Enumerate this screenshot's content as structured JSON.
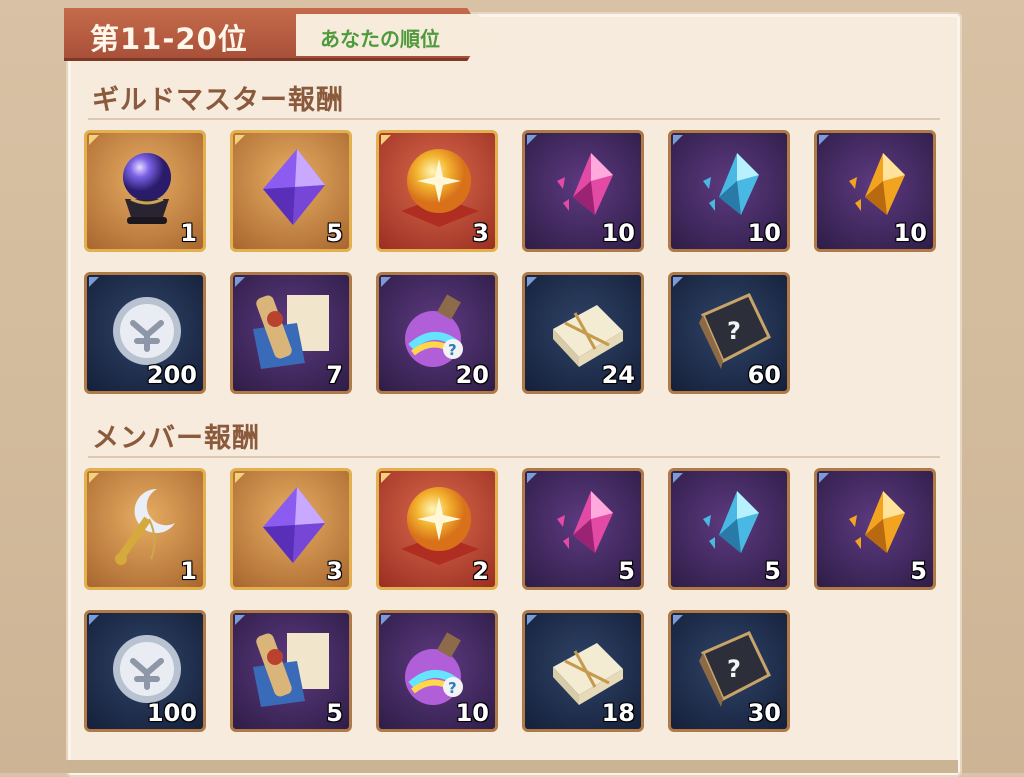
{
  "header": {
    "rank_title": "第11-20位",
    "your_rank_label": "あなたの順位"
  },
  "sections": [
    {
      "title": "ギルドマスター報酬",
      "items": [
        {
          "icon": "crystal-ball-icon",
          "count": "1",
          "frame": "gold"
        },
        {
          "icon": "purple-diamond-icon",
          "count": "5",
          "frame": "gold"
        },
        {
          "icon": "golden-orb-icon",
          "count": "3",
          "frame": "red"
        },
        {
          "icon": "pink-crystal-icon",
          "count": "10",
          "frame": "purple"
        },
        {
          "icon": "blue-crystal-icon",
          "count": "10",
          "frame": "purple"
        },
        {
          "icon": "gold-crystal-icon",
          "count": "10",
          "frame": "purple"
        },
        {
          "icon": "silver-coin-icon",
          "count": "200",
          "frame": "navy"
        },
        {
          "icon": "scroll-book-icon",
          "count": "7",
          "frame": "purple"
        },
        {
          "icon": "potion-icon",
          "count": "20",
          "frame": "purple"
        },
        {
          "icon": "paper-bundle-icon",
          "count": "24",
          "frame": "navy"
        },
        {
          "icon": "mystery-book-icon",
          "count": "60",
          "frame": "navy"
        }
      ]
    },
    {
      "title": "メンバー報酬",
      "items": [
        {
          "icon": "moon-key-icon",
          "count": "1",
          "frame": "gold"
        },
        {
          "icon": "purple-diamond-icon",
          "count": "3",
          "frame": "gold"
        },
        {
          "icon": "golden-orb-icon",
          "count": "2",
          "frame": "red"
        },
        {
          "icon": "pink-crystal-icon",
          "count": "5",
          "frame": "purple"
        },
        {
          "icon": "blue-crystal-icon",
          "count": "5",
          "frame": "purple"
        },
        {
          "icon": "gold-crystal-icon",
          "count": "5",
          "frame": "purple"
        },
        {
          "icon": "silver-coin-icon",
          "count": "100",
          "frame": "navy"
        },
        {
          "icon": "scroll-book-icon",
          "count": "5",
          "frame": "purple"
        },
        {
          "icon": "potion-icon",
          "count": "10",
          "frame": "purple"
        },
        {
          "icon": "paper-bundle-icon",
          "count": "18",
          "frame": "navy"
        },
        {
          "icon": "mystery-book-icon",
          "count": "30",
          "frame": "navy"
        }
      ]
    }
  ],
  "colors": {
    "panel": "#f6ebdd",
    "ribbon": "#b85c42",
    "section_title": "#8b5a3c",
    "rank_green": "#4f9a3c"
  }
}
